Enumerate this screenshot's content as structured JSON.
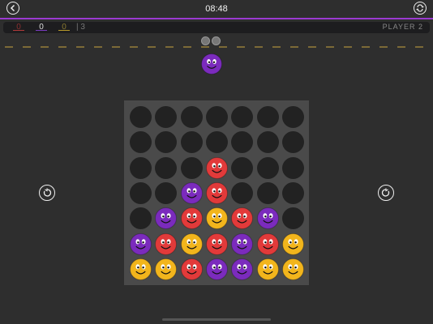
{
  "header": {
    "time": "08:48",
    "back_icon": "chevron-left-icon",
    "swap_icon": "refresh-icon"
  },
  "scores": [
    {
      "value": "0",
      "color": "#b23a3a",
      "text_color": "#8a3030"
    },
    {
      "value": "0",
      "color": "#7a3bbf",
      "text_color": "#dddddd"
    },
    {
      "value": "0",
      "color": "#b89a2a",
      "text_color": "#8a7a30"
    }
  ],
  "score_separator": "| 3",
  "turn_label": "PLAYER 2",
  "colors": {
    "red": "#e23a3a",
    "purple": "#7b2bbd",
    "yellow": "#f2b51c",
    "empty": "#222222",
    "accent": "#9b3ad1"
  },
  "current_piece": "purple",
  "board": [
    [
      "",
      "",
      "",
      "",
      "",
      "",
      ""
    ],
    [
      "",
      "",
      "",
      "",
      "",
      "",
      ""
    ],
    [
      "",
      "",
      "",
      "red",
      "",
      "",
      ""
    ],
    [
      "",
      "",
      "purple",
      "red",
      "",
      "",
      ""
    ],
    [
      "",
      "purple",
      "red",
      "yellow",
      "red",
      "purple",
      ""
    ],
    [
      "purple",
      "red",
      "yellow",
      "red",
      "purple",
      "red",
      "yellow"
    ],
    [
      "yellow",
      "yellow",
      "red",
      "purple",
      "purple",
      "yellow",
      "yellow"
    ]
  ],
  "controls": {
    "rotate_left_icon": "rotate-left-icon",
    "rotate_right_icon": "rotate-right-icon"
  }
}
